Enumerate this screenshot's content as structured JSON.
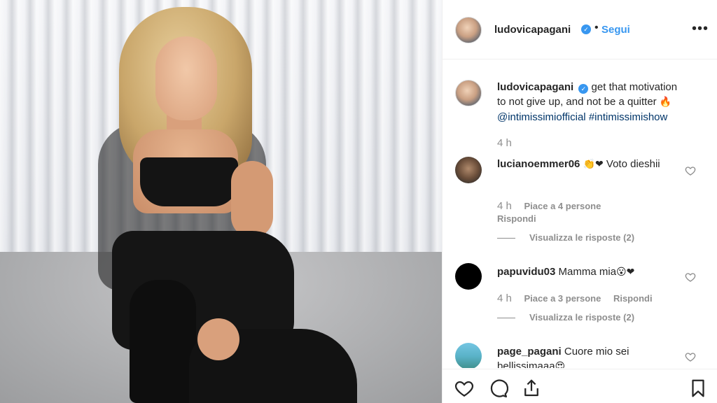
{
  "post": {
    "username": "ludovicapagani",
    "verified": true,
    "separator": "•",
    "follow_label": "Segui",
    "more_label": "•••"
  },
  "caption": {
    "username": "ludovicapagani",
    "text": "get that motivation to not give up, and not be a quitter",
    "emoji": "🔥",
    "mention": "@intimissimiofficial",
    "hashtag": "#intimissimishow",
    "time": "4 h"
  },
  "comments": [
    {
      "username": "lucianoemmer06",
      "emoji": "👏❤",
      "text": "Voto dieshii",
      "time": "4 h",
      "likes": "Piace a 4 persone",
      "reply_label": "Rispondi",
      "view_replies": "Visualizza le risposte (2)"
    },
    {
      "username": "papuvidu03",
      "text": "Mamma mia",
      "emoji": "😮❤",
      "time": "4 h",
      "likes": "Piace a 3 persone",
      "reply_label": "Rispondi",
      "view_replies": "Visualizza le risposte (2)"
    },
    {
      "username": "page_pagani",
      "text": "Cuore mio sei bellissimaaa",
      "emoji": "😍"
    }
  ],
  "icons": {
    "like": "heart-icon",
    "comment": "comment-icon",
    "share": "share-icon",
    "save": "bookmark-icon"
  },
  "colors": {
    "link_blue": "#3897f0",
    "mention_blue": "#003569",
    "muted": "#8e8e8e",
    "text": "#262626"
  }
}
